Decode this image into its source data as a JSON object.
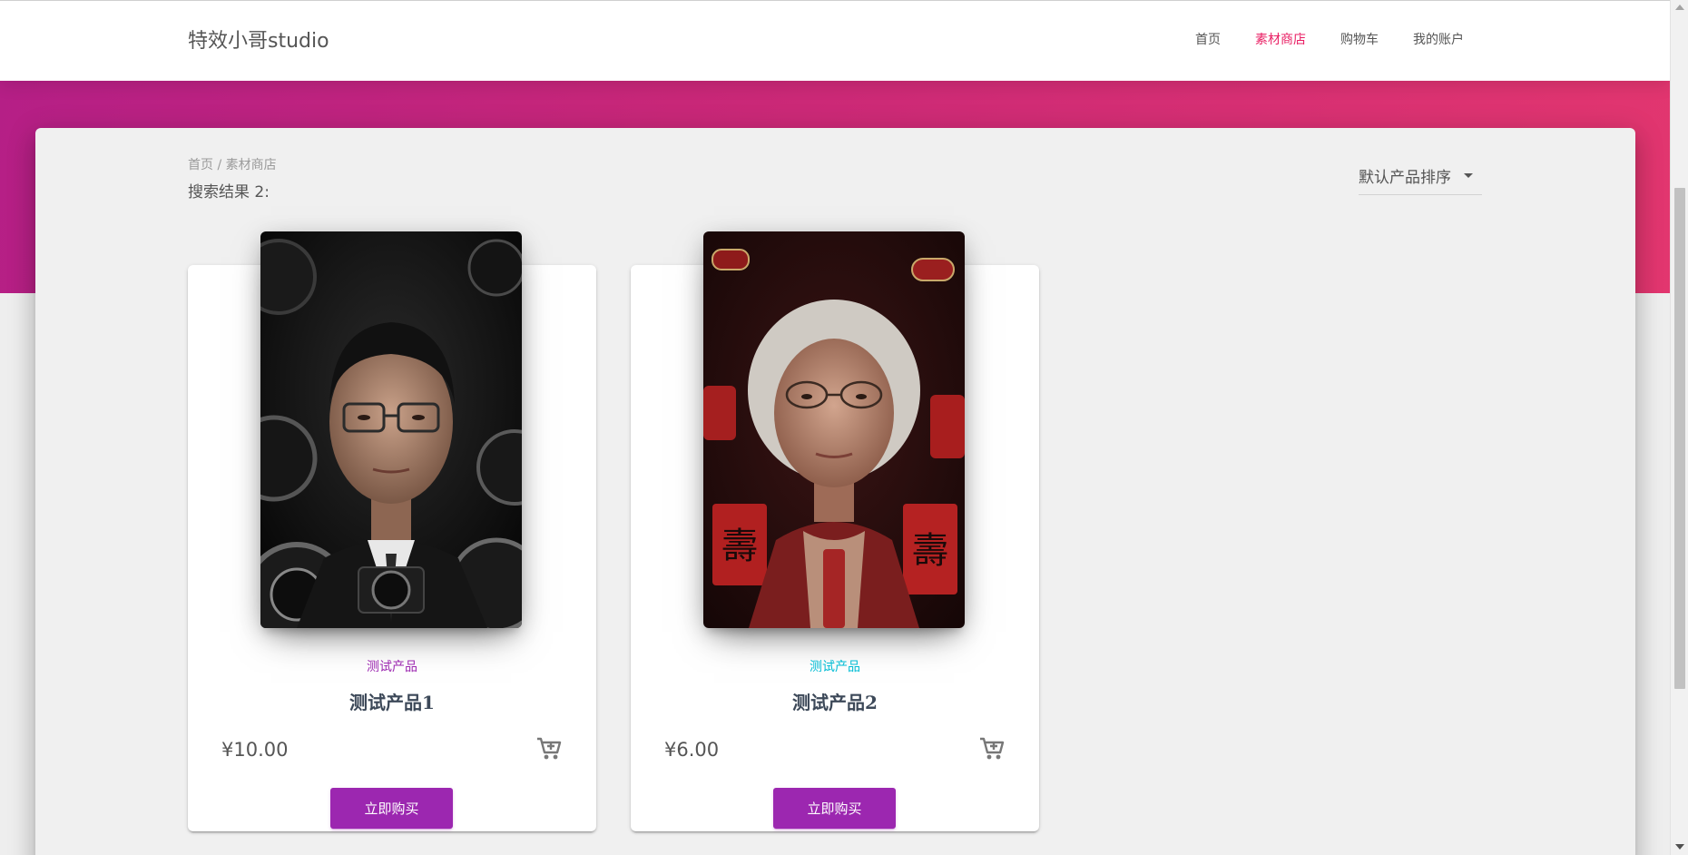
{
  "header": {
    "brand": "特效小哥studio",
    "nav": [
      {
        "label": "首页"
      },
      {
        "label": "素材商店",
        "active": true
      },
      {
        "label": "购物车"
      },
      {
        "label": "我的账户"
      }
    ]
  },
  "breadcrumb": {
    "home": "首页",
    "separator": " / ",
    "current": "素材商店"
  },
  "results_label": "搜索结果 2:",
  "sort": {
    "selected": "默认产品排序"
  },
  "products": [
    {
      "category": "测试产品",
      "category_color": "#9c27b0",
      "title": "测试产品1",
      "price": "¥10.00",
      "buy_label": "立即购买",
      "image_icon": "portrait-man-cameras-image"
    },
    {
      "category": "测试产品",
      "category_color": "#00bcd4",
      "title": "测试产品2",
      "price": "¥6.00",
      "buy_label": "立即购买",
      "image_icon": "portrait-elderly-woman-red-image"
    }
  ],
  "colors": {
    "accent": "#e91e63",
    "button": "#9c27b0",
    "hero_gradient_start": "#b51f86",
    "hero_gradient_end": "#e2366f"
  }
}
